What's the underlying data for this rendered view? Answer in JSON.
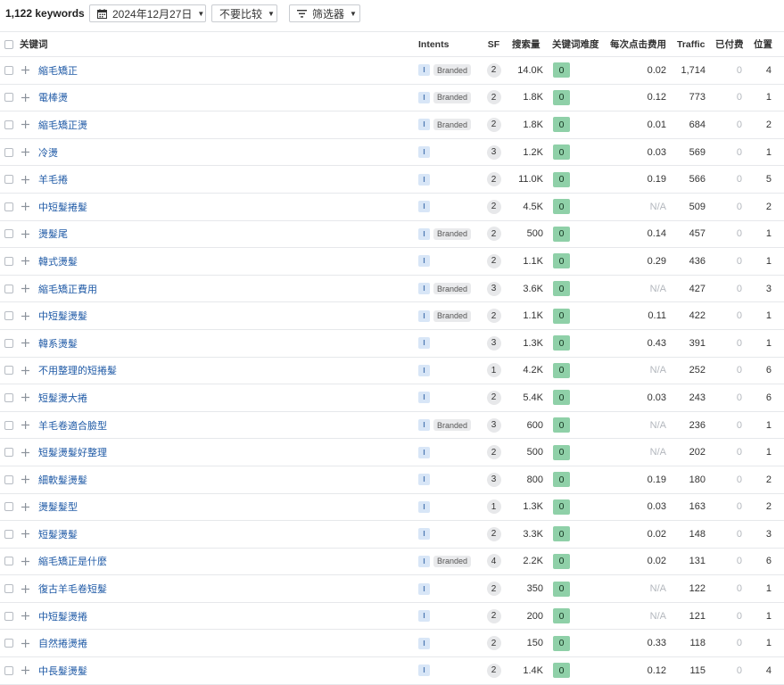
{
  "toolbar": {
    "keyword_count": "1,122 keywords",
    "date_label": "2024年12月27日",
    "compare_label": "不要比较",
    "filter_label": "筛选器"
  },
  "columns": {
    "keyword": "关键词",
    "intents": "Intents",
    "sf": "SF",
    "volume": "搜索量",
    "kd": "关键词难度",
    "cpc": "每次点击费用",
    "traffic": "Traffic",
    "paid": "已付费",
    "position": "位置"
  },
  "colors": {
    "link": "#1f5aa6",
    "kd_green": "#8fd0a8",
    "intent_blue": "#d8e6f7"
  },
  "rows": [
    {
      "keyword": "縮毛矯正",
      "intent": "I",
      "branded": "Branded",
      "sf": "2",
      "volume": "14.0K",
      "kd": "0",
      "cpc": "0.02",
      "traffic": "1,714",
      "paid": "0",
      "position": "4"
    },
    {
      "keyword": "電棒燙",
      "intent": "I",
      "branded": "Branded",
      "sf": "2",
      "volume": "1.8K",
      "kd": "0",
      "cpc": "0.12",
      "traffic": "773",
      "paid": "0",
      "position": "1"
    },
    {
      "keyword": "縮毛矯正燙",
      "intent": "I",
      "branded": "Branded",
      "sf": "2",
      "volume": "1.8K",
      "kd": "0",
      "cpc": "0.01",
      "traffic": "684",
      "paid": "0",
      "position": "2"
    },
    {
      "keyword": "冷燙",
      "intent": "I",
      "branded": "",
      "sf": "3",
      "volume": "1.2K",
      "kd": "0",
      "cpc": "0.03",
      "traffic": "569",
      "paid": "0",
      "position": "1"
    },
    {
      "keyword": "羊毛捲",
      "intent": "I",
      "branded": "",
      "sf": "2",
      "volume": "11.0K",
      "kd": "0",
      "cpc": "0.19",
      "traffic": "566",
      "paid": "0",
      "position": "5"
    },
    {
      "keyword": "中短髮捲髮",
      "intent": "I",
      "branded": "",
      "sf": "2",
      "volume": "4.5K",
      "kd": "0",
      "cpc": "N/A",
      "traffic": "509",
      "paid": "0",
      "position": "2"
    },
    {
      "keyword": "燙髮尾",
      "intent": "I",
      "branded": "Branded",
      "sf": "2",
      "volume": "500",
      "kd": "0",
      "cpc": "0.14",
      "traffic": "457",
      "paid": "0",
      "position": "1"
    },
    {
      "keyword": "韓式燙髮",
      "intent": "I",
      "branded": "",
      "sf": "2",
      "volume": "1.1K",
      "kd": "0",
      "cpc": "0.29",
      "traffic": "436",
      "paid": "0",
      "position": "1"
    },
    {
      "keyword": "縮毛矯正費用",
      "intent": "I",
      "branded": "Branded",
      "sf": "3",
      "volume": "3.6K",
      "kd": "0",
      "cpc": "N/A",
      "traffic": "427",
      "paid": "0",
      "position": "3"
    },
    {
      "keyword": "中短髮燙髮",
      "intent": "I",
      "branded": "Branded",
      "sf": "2",
      "volume": "1.1K",
      "kd": "0",
      "cpc": "0.11",
      "traffic": "422",
      "paid": "0",
      "position": "1"
    },
    {
      "keyword": "韓系燙髮",
      "intent": "I",
      "branded": "",
      "sf": "3",
      "volume": "1.3K",
      "kd": "0",
      "cpc": "0.43",
      "traffic": "391",
      "paid": "0",
      "position": "1"
    },
    {
      "keyword": "不用整理的短捲髮",
      "intent": "I",
      "branded": "",
      "sf": "1",
      "volume": "4.2K",
      "kd": "0",
      "cpc": "N/A",
      "traffic": "252",
      "paid": "0",
      "position": "6"
    },
    {
      "keyword": "短髮燙大捲",
      "intent": "I",
      "branded": "",
      "sf": "2",
      "volume": "5.4K",
      "kd": "0",
      "cpc": "0.03",
      "traffic": "243",
      "paid": "0",
      "position": "6"
    },
    {
      "keyword": "羊毛卷適合臉型",
      "intent": "I",
      "branded": "Branded",
      "sf": "3",
      "volume": "600",
      "kd": "0",
      "cpc": "N/A",
      "traffic": "236",
      "paid": "0",
      "position": "1"
    },
    {
      "keyword": "短髮燙髮好整理",
      "intent": "I",
      "branded": "",
      "sf": "2",
      "volume": "500",
      "kd": "0",
      "cpc": "N/A",
      "traffic": "202",
      "paid": "0",
      "position": "1"
    },
    {
      "keyword": "細軟髮燙髮",
      "intent": "I",
      "branded": "",
      "sf": "3",
      "volume": "800",
      "kd": "0",
      "cpc": "0.19",
      "traffic": "180",
      "paid": "0",
      "position": "2"
    },
    {
      "keyword": "燙髮髮型",
      "intent": "I",
      "branded": "",
      "sf": "1",
      "volume": "1.3K",
      "kd": "0",
      "cpc": "0.03",
      "traffic": "163",
      "paid": "0",
      "position": "2"
    },
    {
      "keyword": "短髮燙髮",
      "intent": "I",
      "branded": "",
      "sf": "2",
      "volume": "3.3K",
      "kd": "0",
      "cpc": "0.02",
      "traffic": "148",
      "paid": "0",
      "position": "3"
    },
    {
      "keyword": "縮毛矯正是什麼",
      "intent": "I",
      "branded": "Branded",
      "sf": "4",
      "volume": "2.2K",
      "kd": "0",
      "cpc": "0.02",
      "traffic": "131",
      "paid": "0",
      "position": "6"
    },
    {
      "keyword": "復古羊毛卷短髮",
      "intent": "I",
      "branded": "",
      "sf": "2",
      "volume": "350",
      "kd": "0",
      "cpc": "N/A",
      "traffic": "122",
      "paid": "0",
      "position": "1"
    },
    {
      "keyword": "中短髮燙捲",
      "intent": "I",
      "branded": "",
      "sf": "2",
      "volume": "200",
      "kd": "0",
      "cpc": "N/A",
      "traffic": "121",
      "paid": "0",
      "position": "1"
    },
    {
      "keyword": "自然捲燙捲",
      "intent": "I",
      "branded": "",
      "sf": "2",
      "volume": "150",
      "kd": "0",
      "cpc": "0.33",
      "traffic": "118",
      "paid": "0",
      "position": "1"
    },
    {
      "keyword": "中長髮燙髮",
      "intent": "I",
      "branded": "",
      "sf": "2",
      "volume": "1.4K",
      "kd": "0",
      "cpc": "0.12",
      "traffic": "115",
      "paid": "0",
      "position": "4"
    }
  ]
}
